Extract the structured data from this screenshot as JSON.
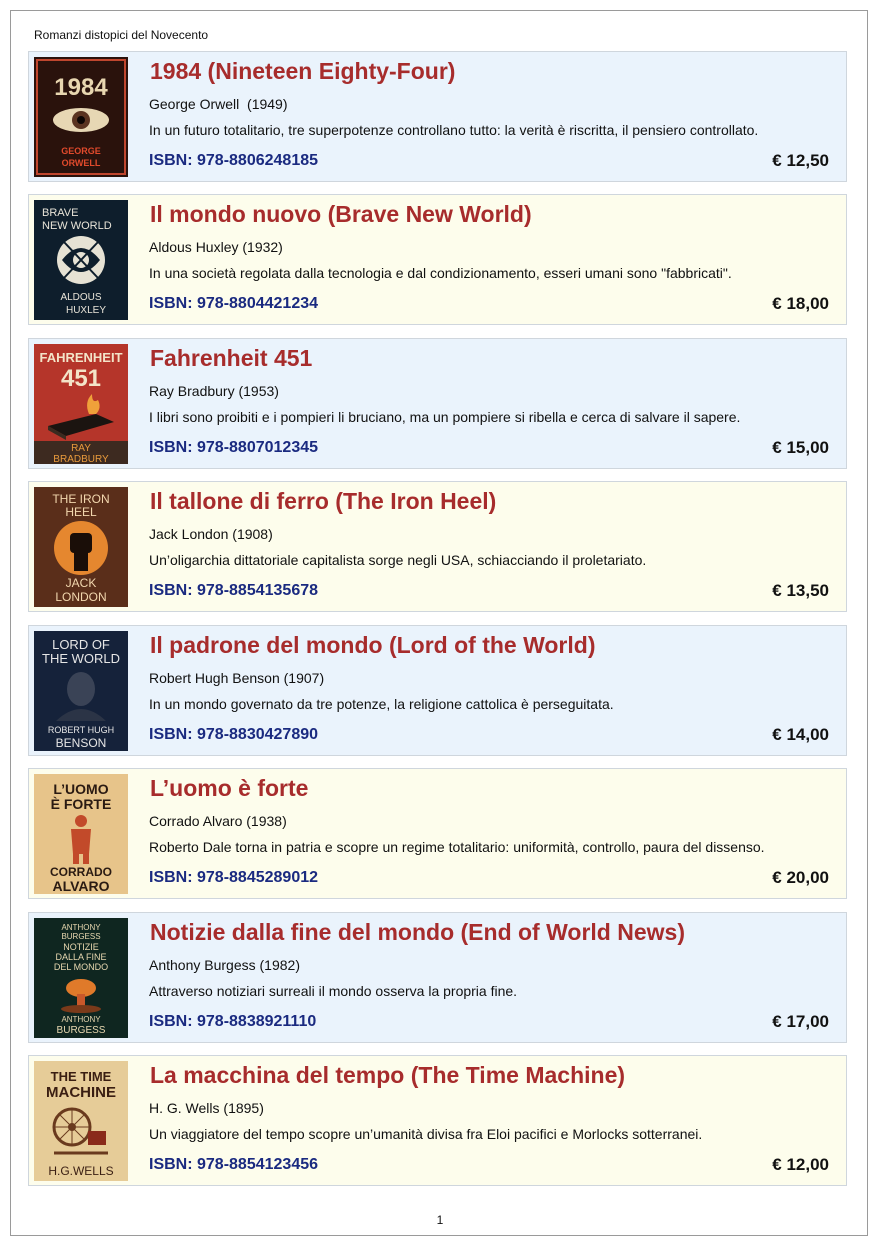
{
  "document": {
    "title": "Romanzi distopici del Novecento",
    "page_number": "1"
  },
  "books": [
    {
      "title": "1984 (Nineteen Eighty-Four)",
      "author_year": "George Orwell  (1949)",
      "description": "In un futuro totalitario, tre superpotenze controllano tutto: la verità è riscritta, il pensiero controllato.",
      "isbn": "ISBN: 978-8806248185",
      "price": "€ 12,50",
      "cover": {
        "top": "1984",
        "bottom": "GEORGE\nORWELL"
      }
    },
    {
      "title": "Il mondo nuovo (Brave New World)",
      "author_year": "Aldous Huxley (1932)",
      "description": "In una società regolata dalla tecnologia e dal condizionamento, esseri umani sono \"fabbricati\".",
      "isbn": "ISBN: 978-8804421234",
      "price": "€ 18,00",
      "cover": {
        "top": "BRAVE\nNEW WORLD",
        "bottom": "ALDOUS\nHUXLEY"
      }
    },
    {
      "title": "Fahrenheit 451",
      "author_year": "Ray Bradbury (1953)",
      "description": "I libri sono proibiti e i pompieri li bruciano, ma un pompiere si ribella e cerca di salvare il sapere.",
      "isbn": "ISBN: 978-8807012345",
      "price": "€ 15,00",
      "cover": {
        "top": "FAHRENHEIT\n451",
        "bottom": "RAY\nBRADBURY"
      }
    },
    {
      "title": "Il tallone di ferro (The Iron Heel)",
      "author_year": "Jack London (1908)",
      "description": "Un’oligarchia dittatoriale capitalista sorge negli USA, schiacciando il proletariato.",
      "isbn": "ISBN: 978-8854135678",
      "price": "€ 13,50",
      "cover": {
        "top": "THE IRON\nHEEL",
        "bottom": "JACK\nLONDON"
      }
    },
    {
      "title": "Il padrone del mondo (Lord of the World)",
      "author_year": "Robert Hugh Benson (1907)",
      "description": "In un mondo governato da tre potenze, la religione cattolica è perseguitata.",
      "isbn": "ISBN: 978-8830427890",
      "price": "€ 14,00",
      "cover": {
        "top": "LORD OF\nTHE WORLD",
        "bottom": "ROBERT HUGH\nBENSON"
      }
    },
    {
      "title": "L’uomo è forte",
      "author_year": "Corrado Alvaro (1938)",
      "description": "Roberto Dale torna in patria e scopre un regime totalitario: uniformità, controllo, paura del dissenso.",
      "isbn": "ISBN: 978-8845289012",
      "price": "€ 20,00",
      "cover": {
        "top": "L’UOMO\nÈ FORTE",
        "bottom": "CORRADO\nALVARO"
      }
    },
    {
      "title": "Notizie dalla fine del mondo (End of World News)",
      "author_year": "Anthony Burgess (1982)",
      "description": "Attraverso notiziari surreali il mondo osserva la propria fine.",
      "isbn": "ISBN: 978-8838921110",
      "price": "€ 17,00",
      "cover": {
        "top": "ANTHONY\nBURGESS\nNOTIZIE\nDALLA FINE\nDEL MONDO",
        "bottom": "ANTHONY\nBURGESS"
      }
    },
    {
      "title": "La macchina del tempo (The Time Machine)",
      "author_year": "H. G. Wells (1895)",
      "description": "Un viaggiatore del tempo scopre un’umanità divisa fra Eloi pacifici e Morlocks sotterranei.",
      "isbn": "ISBN: 978-8854123456",
      "price": "€ 12,00",
      "cover": {
        "top": "THE TIME\nMACHINE",
        "bottom": "H.G.WELLS"
      }
    }
  ]
}
